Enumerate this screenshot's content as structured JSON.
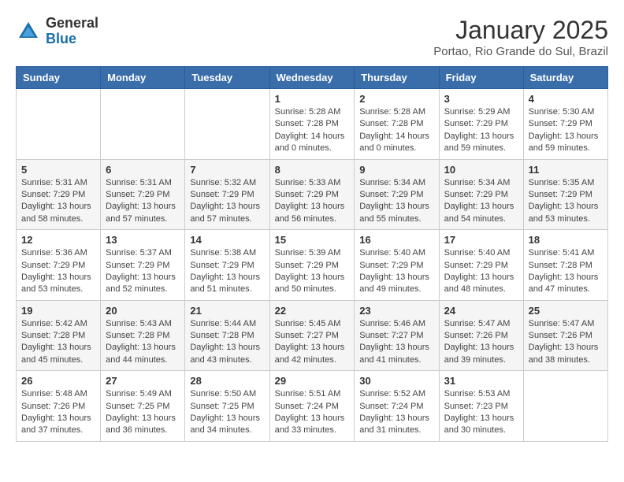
{
  "header": {
    "logo_general": "General",
    "logo_blue": "Blue",
    "title": "January 2025",
    "subtitle": "Portao, Rio Grande do Sul, Brazil"
  },
  "weekdays": [
    "Sunday",
    "Monday",
    "Tuesday",
    "Wednesday",
    "Thursday",
    "Friday",
    "Saturday"
  ],
  "weeks": [
    [
      {
        "day": "",
        "sunrise": "",
        "sunset": "",
        "daylight": ""
      },
      {
        "day": "",
        "sunrise": "",
        "sunset": "",
        "daylight": ""
      },
      {
        "day": "",
        "sunrise": "",
        "sunset": "",
        "daylight": ""
      },
      {
        "day": "1",
        "sunrise": "Sunrise: 5:28 AM",
        "sunset": "Sunset: 7:28 PM",
        "daylight": "Daylight: 14 hours and 0 minutes."
      },
      {
        "day": "2",
        "sunrise": "Sunrise: 5:28 AM",
        "sunset": "Sunset: 7:28 PM",
        "daylight": "Daylight: 14 hours and 0 minutes."
      },
      {
        "day": "3",
        "sunrise": "Sunrise: 5:29 AM",
        "sunset": "Sunset: 7:29 PM",
        "daylight": "Daylight: 13 hours and 59 minutes."
      },
      {
        "day": "4",
        "sunrise": "Sunrise: 5:30 AM",
        "sunset": "Sunset: 7:29 PM",
        "daylight": "Daylight: 13 hours and 59 minutes."
      }
    ],
    [
      {
        "day": "5",
        "sunrise": "Sunrise: 5:31 AM",
        "sunset": "Sunset: 7:29 PM",
        "daylight": "Daylight: 13 hours and 58 minutes."
      },
      {
        "day": "6",
        "sunrise": "Sunrise: 5:31 AM",
        "sunset": "Sunset: 7:29 PM",
        "daylight": "Daylight: 13 hours and 57 minutes."
      },
      {
        "day": "7",
        "sunrise": "Sunrise: 5:32 AM",
        "sunset": "Sunset: 7:29 PM",
        "daylight": "Daylight: 13 hours and 57 minutes."
      },
      {
        "day": "8",
        "sunrise": "Sunrise: 5:33 AM",
        "sunset": "Sunset: 7:29 PM",
        "daylight": "Daylight: 13 hours and 56 minutes."
      },
      {
        "day": "9",
        "sunrise": "Sunrise: 5:34 AM",
        "sunset": "Sunset: 7:29 PM",
        "daylight": "Daylight: 13 hours and 55 minutes."
      },
      {
        "day": "10",
        "sunrise": "Sunrise: 5:34 AM",
        "sunset": "Sunset: 7:29 PM",
        "daylight": "Daylight: 13 hours and 54 minutes."
      },
      {
        "day": "11",
        "sunrise": "Sunrise: 5:35 AM",
        "sunset": "Sunset: 7:29 PM",
        "daylight": "Daylight: 13 hours and 53 minutes."
      }
    ],
    [
      {
        "day": "12",
        "sunrise": "Sunrise: 5:36 AM",
        "sunset": "Sunset: 7:29 PM",
        "daylight": "Daylight: 13 hours and 53 minutes."
      },
      {
        "day": "13",
        "sunrise": "Sunrise: 5:37 AM",
        "sunset": "Sunset: 7:29 PM",
        "daylight": "Daylight: 13 hours and 52 minutes."
      },
      {
        "day": "14",
        "sunrise": "Sunrise: 5:38 AM",
        "sunset": "Sunset: 7:29 PM",
        "daylight": "Daylight: 13 hours and 51 minutes."
      },
      {
        "day": "15",
        "sunrise": "Sunrise: 5:39 AM",
        "sunset": "Sunset: 7:29 PM",
        "daylight": "Daylight: 13 hours and 50 minutes."
      },
      {
        "day": "16",
        "sunrise": "Sunrise: 5:40 AM",
        "sunset": "Sunset: 7:29 PM",
        "daylight": "Daylight: 13 hours and 49 minutes."
      },
      {
        "day": "17",
        "sunrise": "Sunrise: 5:40 AM",
        "sunset": "Sunset: 7:29 PM",
        "daylight": "Daylight: 13 hours and 48 minutes."
      },
      {
        "day": "18",
        "sunrise": "Sunrise: 5:41 AM",
        "sunset": "Sunset: 7:28 PM",
        "daylight": "Daylight: 13 hours and 47 minutes."
      }
    ],
    [
      {
        "day": "19",
        "sunrise": "Sunrise: 5:42 AM",
        "sunset": "Sunset: 7:28 PM",
        "daylight": "Daylight: 13 hours and 45 minutes."
      },
      {
        "day": "20",
        "sunrise": "Sunrise: 5:43 AM",
        "sunset": "Sunset: 7:28 PM",
        "daylight": "Daylight: 13 hours and 44 minutes."
      },
      {
        "day": "21",
        "sunrise": "Sunrise: 5:44 AM",
        "sunset": "Sunset: 7:28 PM",
        "daylight": "Daylight: 13 hours and 43 minutes."
      },
      {
        "day": "22",
        "sunrise": "Sunrise: 5:45 AM",
        "sunset": "Sunset: 7:27 PM",
        "daylight": "Daylight: 13 hours and 42 minutes."
      },
      {
        "day": "23",
        "sunrise": "Sunrise: 5:46 AM",
        "sunset": "Sunset: 7:27 PM",
        "daylight": "Daylight: 13 hours and 41 minutes."
      },
      {
        "day": "24",
        "sunrise": "Sunrise: 5:47 AM",
        "sunset": "Sunset: 7:26 PM",
        "daylight": "Daylight: 13 hours and 39 minutes."
      },
      {
        "day": "25",
        "sunrise": "Sunrise: 5:47 AM",
        "sunset": "Sunset: 7:26 PM",
        "daylight": "Daylight: 13 hours and 38 minutes."
      }
    ],
    [
      {
        "day": "26",
        "sunrise": "Sunrise: 5:48 AM",
        "sunset": "Sunset: 7:26 PM",
        "daylight": "Daylight: 13 hours and 37 minutes."
      },
      {
        "day": "27",
        "sunrise": "Sunrise: 5:49 AM",
        "sunset": "Sunset: 7:25 PM",
        "daylight": "Daylight: 13 hours and 36 minutes."
      },
      {
        "day": "28",
        "sunrise": "Sunrise: 5:50 AM",
        "sunset": "Sunset: 7:25 PM",
        "daylight": "Daylight: 13 hours and 34 minutes."
      },
      {
        "day": "29",
        "sunrise": "Sunrise: 5:51 AM",
        "sunset": "Sunset: 7:24 PM",
        "daylight": "Daylight: 13 hours and 33 minutes."
      },
      {
        "day": "30",
        "sunrise": "Sunrise: 5:52 AM",
        "sunset": "Sunset: 7:24 PM",
        "daylight": "Daylight: 13 hours and 31 minutes."
      },
      {
        "day": "31",
        "sunrise": "Sunrise: 5:53 AM",
        "sunset": "Sunset: 7:23 PM",
        "daylight": "Daylight: 13 hours and 30 minutes."
      },
      {
        "day": "",
        "sunrise": "",
        "sunset": "",
        "daylight": ""
      }
    ]
  ]
}
